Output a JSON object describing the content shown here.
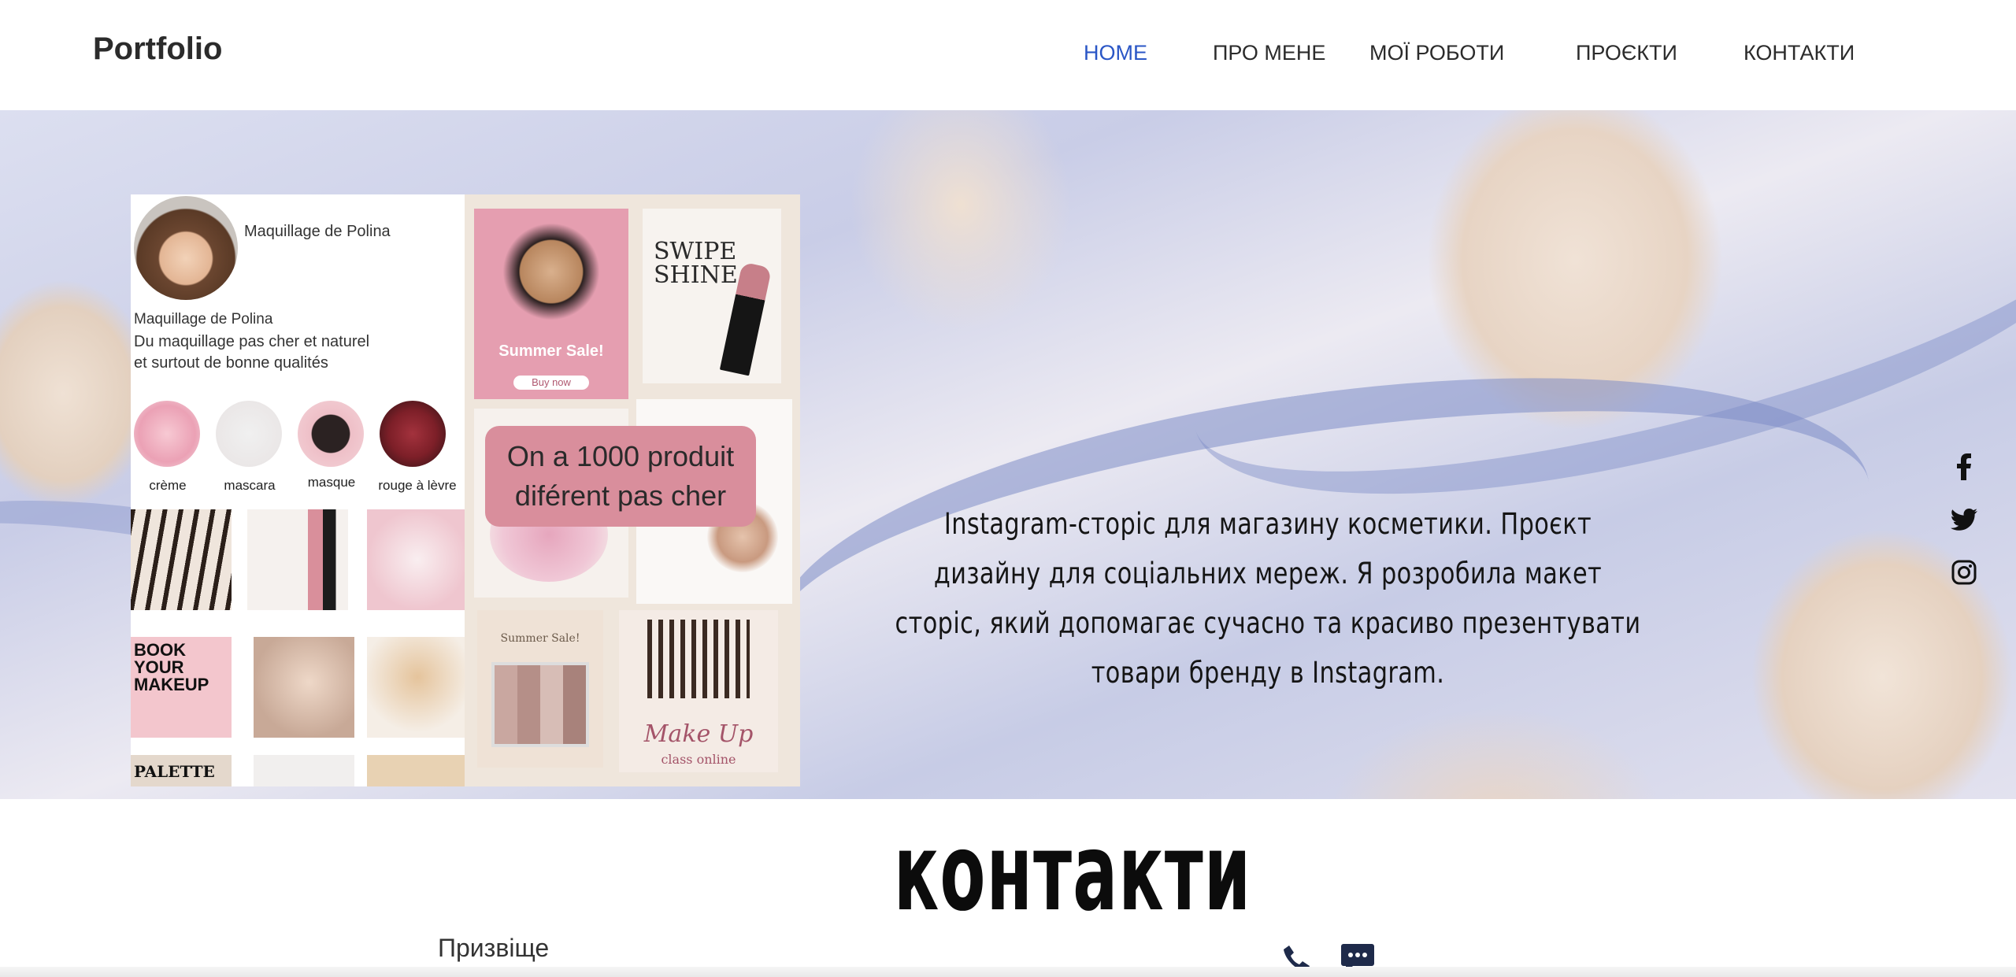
{
  "header": {
    "logo": "Portfolio",
    "nav": {
      "home": "HOME",
      "about": "ПРО МЕНЕ",
      "works": "МОЇ РОБОТИ",
      "projects": "ПРОЄКТИ",
      "contacts": "КОНТАКТИ"
    },
    "active_color": "#2a56c6"
  },
  "hero": {
    "image": {
      "profile_name": "Maquillage de Polina",
      "bio_name": "Maquillage de Polina",
      "bio_line1": "Du maquillage pas cher et naturel",
      "bio_line2": "et surtout de bonne qualités",
      "highlights": [
        "crème",
        "mascara",
        "masque",
        "rouge à lèvre"
      ],
      "tile_book": "BOOK YOUR MAKEUP",
      "tile_palette": "PALETTE",
      "summer_sale": "Summer Sale!",
      "buy_now": "Buy now",
      "swipe": "SWIPE SHINE",
      "promo_line1": "On a 1000 produit",
      "promo_line2": "diférent pas cher",
      "summer_sale_2": "Summer Sale!",
      "make_up": "Make Up",
      "class_online": "class online"
    },
    "description": "Instagram-сторіс для магазину косметики. Проєкт дизайну для соціальних мереж. Я розробила макет сторіс, який допомагає сучасно та красиво презентувати товари бренду в Instagram."
  },
  "social": [
    "facebook-icon",
    "twitter-icon",
    "instagram-icon"
  ],
  "contacts": {
    "title": "контакти",
    "surname_label": "Призвіще",
    "icons": [
      "phone-icon",
      "chat-icon"
    ],
    "icon_color": "#1e2a4a"
  }
}
